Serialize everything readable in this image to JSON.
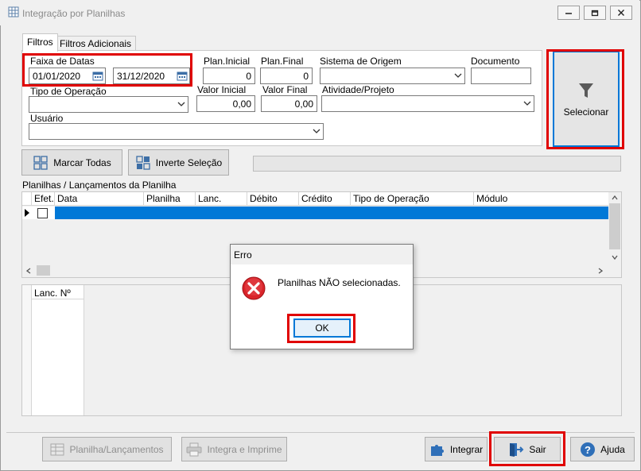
{
  "window": {
    "title": "Integração por Planilhas",
    "minimize_icon": "minimize-icon",
    "restore_icon": "restore-icon",
    "close_icon": "close-icon"
  },
  "tabs": [
    {
      "label": "Filtros",
      "active": true
    },
    {
      "label": "Filtros Adicionais",
      "active": false
    }
  ],
  "filters": {
    "date_range_label": "Faixa de Datas",
    "date_start": "01/01/2020",
    "date_end": "31/12/2020",
    "plan_inicial_label": "Plan.Inicial",
    "plan_inicial_value": "0",
    "plan_final_label": "Plan.Final",
    "plan_final_value": "0",
    "sistema_origem_label": "Sistema de Origem",
    "sistema_origem_value": "",
    "documento_label": "Documento",
    "documento_value": "",
    "tipo_operacao_label": "Tipo de Operação",
    "tipo_operacao_value": "",
    "valor_inicial_label": "Valor Inicial",
    "valor_inicial_value": "0,00",
    "valor_final_label": "Valor Final",
    "valor_final_value": "0,00",
    "atividade_projeto_label": "Atividade/Projeto",
    "atividade_projeto_value": "",
    "usuario_label": "Usuário",
    "usuario_value": ""
  },
  "selecionar_button": {
    "label": "Selecionar",
    "icon": "filter-icon"
  },
  "actions": {
    "marcar_todas": "Marcar Todas",
    "inverte_selecao": "Inverte Seleção"
  },
  "grid": {
    "title": "Planilhas / Lançamentos da Planilha",
    "columns": [
      "Efet.",
      "Data",
      "Planilha",
      "Lanc.",
      "Débito",
      "Crédito",
      "Tipo de Operação",
      "Módulo"
    ]
  },
  "lower_grid": {
    "columns": [
      "Lanc. Nº"
    ]
  },
  "dialog": {
    "title": "Erro",
    "message": "Planilhas NÃO selecionadas.",
    "ok_label": "OK",
    "icon": "error-icon"
  },
  "footer": {
    "planilha_lancamentos": "Planilha/Lançamentos",
    "integra_imprime": "Integra e Imprime",
    "integrar": "Integrar",
    "sair": "Sair",
    "ajuda": "Ajuda"
  },
  "colors": {
    "highlight_red": "#e00000",
    "selection_blue": "#0078d7",
    "error_red": "#d9242a"
  }
}
